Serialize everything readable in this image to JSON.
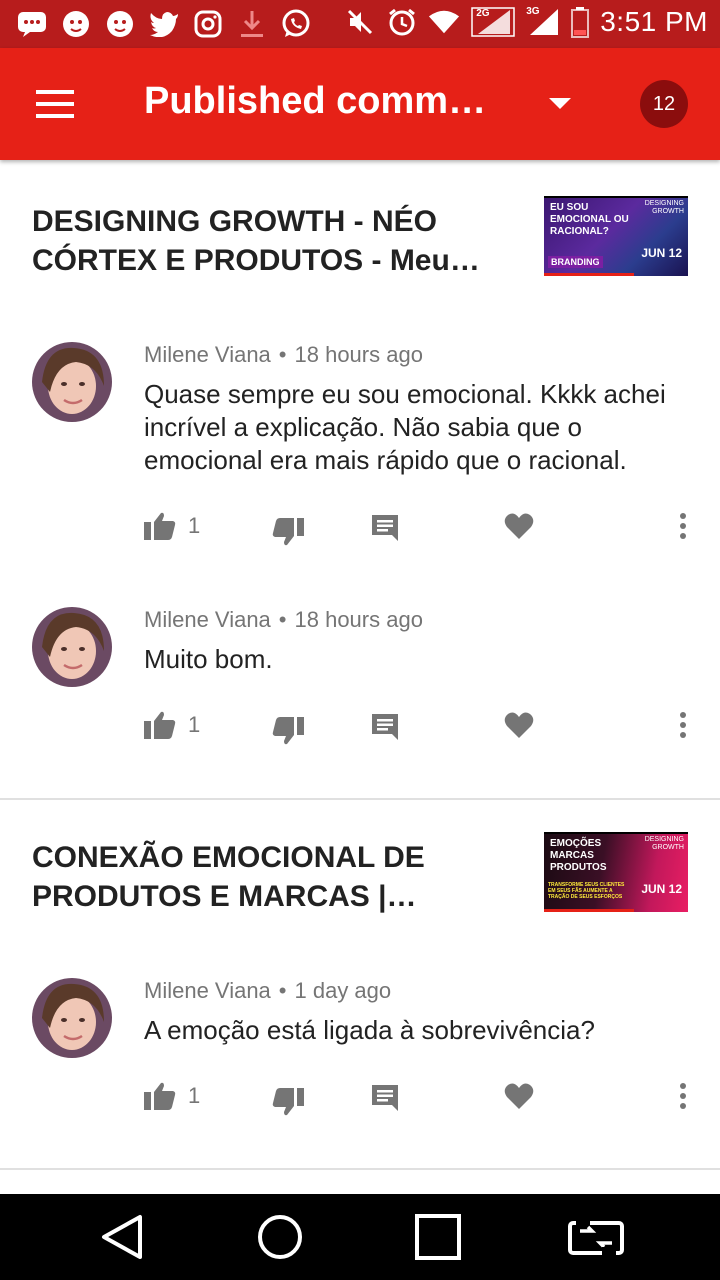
{
  "status_bar": {
    "time": "3:51 PM",
    "network_1": "2G",
    "network_2": "3G",
    "left_icons": [
      "messages-icon",
      "mailchimp-icon",
      "mailchimp-icon",
      "twitter-icon",
      "instagram-icon",
      "download-icon",
      "whatsapp-icon"
    ],
    "right_icons": [
      "mute-icon",
      "alarm-icon",
      "wifi-icon",
      "signal-icon",
      "signal-icon",
      "battery-icon"
    ]
  },
  "app_bar": {
    "title": "Published comme…",
    "count": "12",
    "color": "#e62117"
  },
  "videos": [
    {
      "title": "DESIGNING GROWTH - NÉO CÓRTEX E PRODUTOS - Meu cé…",
      "thumb_text": "EU SOU EMOCIONAL OU RACIONAL?",
      "thumb_tag": "BRANDING",
      "thumb_logo": "DESIGNING GROWTH",
      "thumb_date": "JUN 12",
      "comments": [
        {
          "author": "Milene Viana",
          "time": "18 hours ago",
          "text": "Quase sempre eu sou emocional. Kkkk achei incrível a explicação. Não sabia que o emocional era mais rápido que o racional.",
          "likes": "1"
        },
        {
          "author": "Milene Viana",
          "time": "18 hours ago",
          "text": "Muito bom.",
          "likes": "1"
        }
      ]
    },
    {
      "title": "CONEXÃO EMOCIONAL DE PRODUTOS E MARCAS | Tomad…",
      "thumb_text": "EMOÇÕES MARCAS PRODUTOS",
      "thumb_sub": "TRANSFORME SEUS CLIENTES EM SEUS FÃS AUMENTE A TRAÇÃO DE SEUS ESFORÇOS",
      "thumb_logo": "DESIGNING GROWTH",
      "thumb_date": "JUN 12",
      "comments": [
        {
          "author": "Milene Viana",
          "time": "1 day ago",
          "text": "A emoção está ligada à sobrevivência?",
          "likes": "1"
        }
      ]
    }
  ]
}
